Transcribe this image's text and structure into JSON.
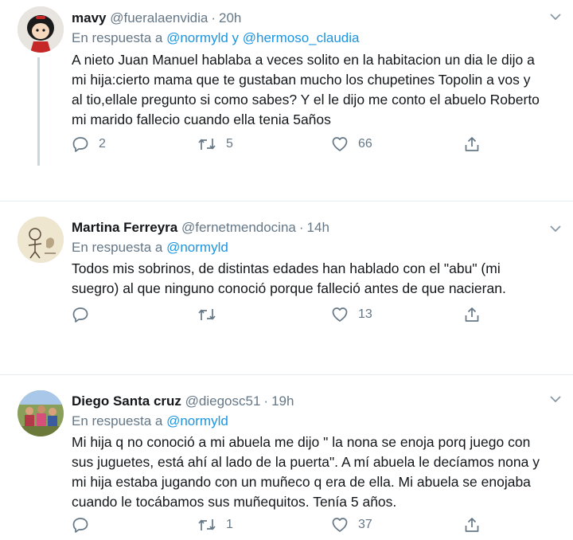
{
  "tweets": [
    {
      "name": "mavy",
      "handle": "@fueralaenvidia",
      "time": "20h",
      "reply_prefix": "En respuesta a ",
      "mention_1": "@normyld",
      "mention_join": " y ",
      "mention_2": "@hermoso_claudia",
      "text": "A nieto Juan Manuel  hablaba a veces solito en la habitacion un dia le dijo a\nmi hija:cierto mama que te gustaban mucho los chupetines Topolin a vos y\nal tio,ellale pregunto si como sabes? Y el le dijo me conto el abuelo Roberto\nmi marido fallecio cuando ella tenia 5años",
      "replies": "2",
      "retweets": "5",
      "likes": "66",
      "avatar_icon": "mafalda-avatar-icon"
    },
    {
      "name": "Martina Ferreyra",
      "handle": "@fernetmendocina",
      "time": "14h",
      "reply_prefix": "En respuesta a ",
      "mention_1": "@normyld",
      "text": "Todos mis sobrinos, de distintas edades han hablado con el \"abu\" (mi\nsuegro) al que ninguno conoció porque falleció antes de que nacieran.",
      "replies": "",
      "retweets": "",
      "likes": "13",
      "avatar_icon": "drawing-avatar-icon"
    },
    {
      "name": "Diego Santa cruz",
      "handle": "@diegosc51",
      "time": "19h",
      "reply_prefix": "En respuesta a ",
      "mention_1": "@normyld",
      "text": "Mi hija q no conoció a mi abuela me dijo \" la nona se enoja porq juego con\nsus juguetes, está ahí al lado de la puerta\". A mí abuela le decíamos nona y\nmi hija estaba jugando con un muñeco q era de ella. Mi abuela se enojaba\ncuando le tocábamos sus muñequitos. Tenía 5 años.",
      "replies": "",
      "retweets": "1",
      "likes": "37",
      "avatar_icon": "group-photo-avatar-icon"
    }
  ],
  "colors": {
    "mention": "#1b95e0",
    "muted": "#657786",
    "separator": "#e6ecf0",
    "thread_line": "#ccd6dd"
  }
}
